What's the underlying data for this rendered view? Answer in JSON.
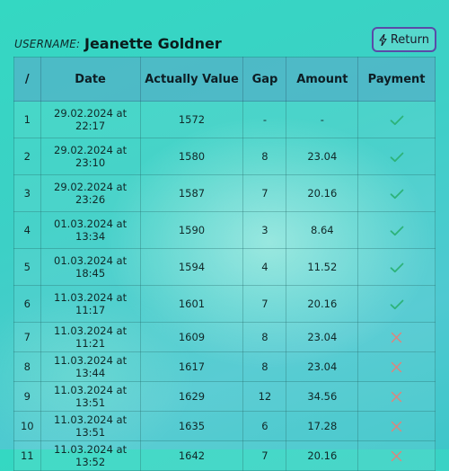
{
  "header": {
    "username_label": "USERNAME:",
    "username": "Jeanette Goldner",
    "return_label": "Return",
    "return_icon": "lightning-icon"
  },
  "colors": {
    "check": "#2db37a",
    "cross": "#e0837b",
    "button_border": "#5a4aa8"
  },
  "table": {
    "columns": [
      "/",
      "Date",
      "Actually Value",
      "Gap",
      "Amount",
      "Payment"
    ],
    "rows": [
      {
        "idx": "1",
        "date": "29.02.2024 at 22:17",
        "value": "1572",
        "gap": "-",
        "amount": "-",
        "payment": "check-icon",
        "size": "tall"
      },
      {
        "idx": "2",
        "date": "29.02.2024 at 23:10",
        "value": "1580",
        "gap": "8",
        "amount": "23.04",
        "payment": "check-icon",
        "size": "tall"
      },
      {
        "idx": "3",
        "date": "29.02.2024 at 23:26",
        "value": "1587",
        "gap": "7",
        "amount": "20.16",
        "payment": "check-icon",
        "size": "tall"
      },
      {
        "idx": "4",
        "date": "01.03.2024 at 13:34",
        "value": "1590",
        "gap": "3",
        "amount": "8.64",
        "payment": "check-icon",
        "size": "tall"
      },
      {
        "idx": "5",
        "date": "01.03.2024 at 18:45",
        "value": "1594",
        "gap": "4",
        "amount": "11.52",
        "payment": "check-icon",
        "size": "tall"
      },
      {
        "idx": "6",
        "date": "11.03.2024 at 11:17",
        "value": "1601",
        "gap": "7",
        "amount": "20.16",
        "payment": "check-icon",
        "size": "tall"
      },
      {
        "idx": "7",
        "date": "11.03.2024 at 11:21",
        "value": "1609",
        "gap": "8",
        "amount": "23.04",
        "payment": "cross-icon",
        "size": "short"
      },
      {
        "idx": "8",
        "date": "11.03.2024 at 13:44",
        "value": "1617",
        "gap": "8",
        "amount": "23.04",
        "payment": "cross-icon",
        "size": "short"
      },
      {
        "idx": "9",
        "date": "11.03.2024 at 13:51",
        "value": "1629",
        "gap": "12",
        "amount": "34.56",
        "payment": "cross-icon",
        "size": "short"
      },
      {
        "idx": "10",
        "date": "11.03.2024 at 13:51",
        "value": "1635",
        "gap": "6",
        "amount": "17.28",
        "payment": "cross-icon",
        "size": "short"
      },
      {
        "idx": "11",
        "date": "11.03.2024 at 13:52",
        "value": "1642",
        "gap": "7",
        "amount": "20.16",
        "payment": "cross-icon",
        "size": "short"
      }
    ]
  }
}
